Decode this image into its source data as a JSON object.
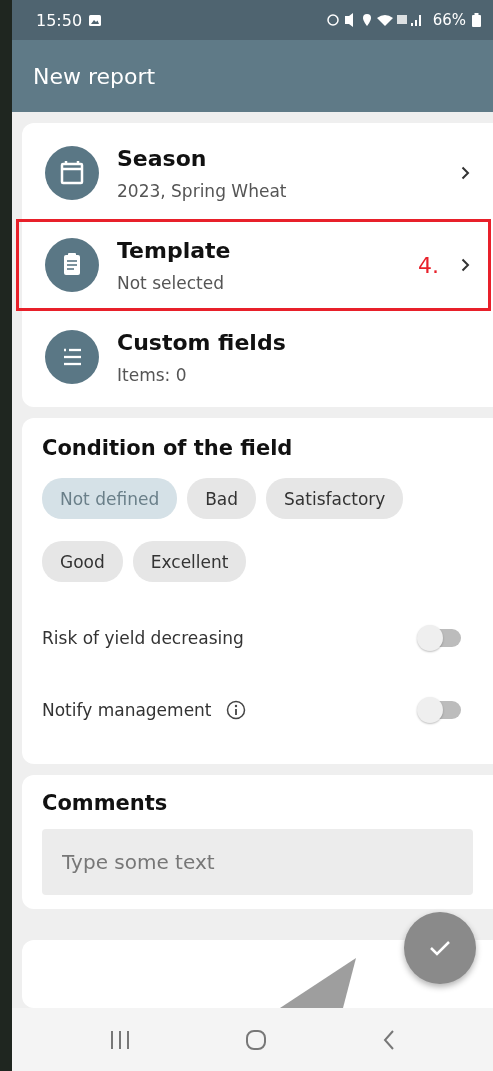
{
  "status_bar": {
    "time": "15:50",
    "battery": "66%"
  },
  "app_bar": {
    "title": "New report"
  },
  "nav_rows": [
    {
      "kind": "calendar",
      "title": "Season",
      "subtitle": "2023, Spring Wheat",
      "chevron": true,
      "highlighted": false
    },
    {
      "kind": "clipboard",
      "title": "Template",
      "subtitle": "Not selected",
      "chevron": true,
      "highlighted": true,
      "annotation": "4."
    },
    {
      "kind": "list",
      "title": "Custom fields",
      "subtitle": "Items: 0",
      "chevron": false,
      "highlighted": false
    }
  ],
  "condition": {
    "title": "Condition of the field",
    "chips": [
      {
        "label": "Not defined",
        "selected": true
      },
      {
        "label": "Bad",
        "selected": false
      },
      {
        "label": "Satisfactory",
        "selected": false
      },
      {
        "label": "Good",
        "selected": false
      },
      {
        "label": "Excellent",
        "selected": false
      }
    ],
    "toggles": [
      {
        "label": "Risk of yield decreasing",
        "on": false,
        "info": false
      },
      {
        "label": "Notify management",
        "on": false,
        "info": true
      }
    ]
  },
  "comments": {
    "title": "Comments",
    "placeholder": "Type some text"
  }
}
